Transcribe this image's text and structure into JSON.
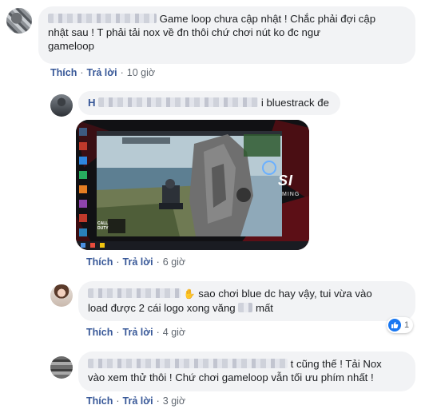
{
  "comments": [
    {
      "name_visible": "Game loop",
      "text": "chưa cập nhật ! Chắc phải đợi cập nhật sau ! T phải tải nox về đn thôi chứ chơi nút ko đc ngư gameloop",
      "line1": "Game loop chưa cập nhật ! Chắc phải đợi cập",
      "line2": "nhật sau ! T phải tải nox về đn thôi chứ chơi nút ko đc ngư",
      "line3": "gameloop",
      "like": "Thích",
      "reply": "Trả lời",
      "time": "10 giờ"
    },
    {
      "name_prefix": "H",
      "text": "i bluestrack đe",
      "like": "Thích",
      "reply": "Trả lời",
      "time": "6 giờ"
    },
    {
      "line1": "sao chơi blue dc hay vậy, tui vừa vào",
      "line2a": "load được 2 cái logo xong văng",
      "line2b": "mất",
      "like": "Thích",
      "reply": "Trả lời",
      "time": "4 giờ",
      "reaction_count": "1"
    },
    {
      "line1": "t cũng thế ! Tải Nox",
      "line2": "vào xem thử thôi ! Chứ chơi gameloop vẫn tối ưu phím nhất !",
      "like": "Thích",
      "reply": "Trả lời",
      "time": "3 giờ"
    }
  ],
  "screenshot_overlay": {
    "brand_fragment": "SI",
    "brand_sub": "MING",
    "game_badge": "CALL DUTY"
  },
  "colors": {
    "link": "#385898",
    "bubble": "#f2f3f5",
    "meta": "#606770",
    "like_blue": "#1877f2"
  }
}
